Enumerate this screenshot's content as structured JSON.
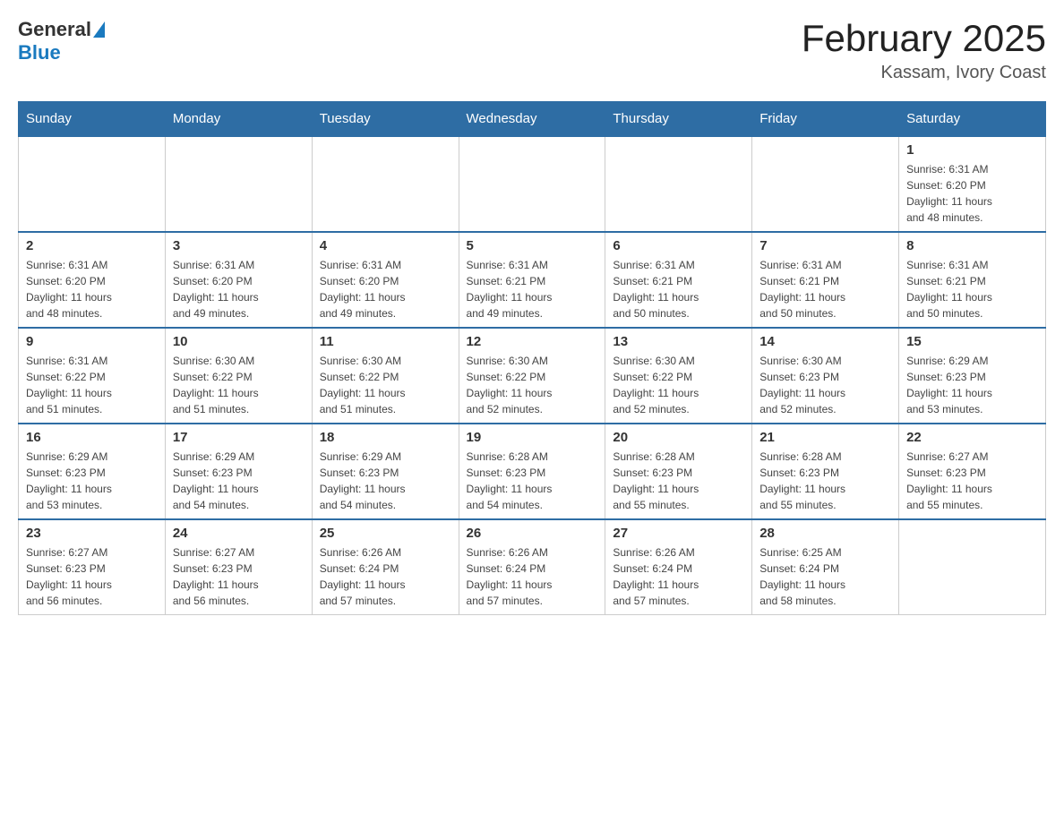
{
  "logo": {
    "text_general": "General",
    "text_blue": "Blue",
    "arrow_char": "▶"
  },
  "title": "February 2025",
  "subtitle": "Kassam, Ivory Coast",
  "days_of_week": [
    "Sunday",
    "Monday",
    "Tuesday",
    "Wednesday",
    "Thursday",
    "Friday",
    "Saturday"
  ],
  "weeks": [
    {
      "days": [
        {
          "date": "",
          "info": ""
        },
        {
          "date": "",
          "info": ""
        },
        {
          "date": "",
          "info": ""
        },
        {
          "date": "",
          "info": ""
        },
        {
          "date": "",
          "info": ""
        },
        {
          "date": "",
          "info": ""
        },
        {
          "date": "1",
          "info": "Sunrise: 6:31 AM\nSunset: 6:20 PM\nDaylight: 11 hours\nand 48 minutes."
        }
      ]
    },
    {
      "days": [
        {
          "date": "2",
          "info": "Sunrise: 6:31 AM\nSunset: 6:20 PM\nDaylight: 11 hours\nand 48 minutes."
        },
        {
          "date": "3",
          "info": "Sunrise: 6:31 AM\nSunset: 6:20 PM\nDaylight: 11 hours\nand 49 minutes."
        },
        {
          "date": "4",
          "info": "Sunrise: 6:31 AM\nSunset: 6:20 PM\nDaylight: 11 hours\nand 49 minutes."
        },
        {
          "date": "5",
          "info": "Sunrise: 6:31 AM\nSunset: 6:21 PM\nDaylight: 11 hours\nand 49 minutes."
        },
        {
          "date": "6",
          "info": "Sunrise: 6:31 AM\nSunset: 6:21 PM\nDaylight: 11 hours\nand 50 minutes."
        },
        {
          "date": "7",
          "info": "Sunrise: 6:31 AM\nSunset: 6:21 PM\nDaylight: 11 hours\nand 50 minutes."
        },
        {
          "date": "8",
          "info": "Sunrise: 6:31 AM\nSunset: 6:21 PM\nDaylight: 11 hours\nand 50 minutes."
        }
      ]
    },
    {
      "days": [
        {
          "date": "9",
          "info": "Sunrise: 6:31 AM\nSunset: 6:22 PM\nDaylight: 11 hours\nand 51 minutes."
        },
        {
          "date": "10",
          "info": "Sunrise: 6:30 AM\nSunset: 6:22 PM\nDaylight: 11 hours\nand 51 minutes."
        },
        {
          "date": "11",
          "info": "Sunrise: 6:30 AM\nSunset: 6:22 PM\nDaylight: 11 hours\nand 51 minutes."
        },
        {
          "date": "12",
          "info": "Sunrise: 6:30 AM\nSunset: 6:22 PM\nDaylight: 11 hours\nand 52 minutes."
        },
        {
          "date": "13",
          "info": "Sunrise: 6:30 AM\nSunset: 6:22 PM\nDaylight: 11 hours\nand 52 minutes."
        },
        {
          "date": "14",
          "info": "Sunrise: 6:30 AM\nSunset: 6:23 PM\nDaylight: 11 hours\nand 52 minutes."
        },
        {
          "date": "15",
          "info": "Sunrise: 6:29 AM\nSunset: 6:23 PM\nDaylight: 11 hours\nand 53 minutes."
        }
      ]
    },
    {
      "days": [
        {
          "date": "16",
          "info": "Sunrise: 6:29 AM\nSunset: 6:23 PM\nDaylight: 11 hours\nand 53 minutes."
        },
        {
          "date": "17",
          "info": "Sunrise: 6:29 AM\nSunset: 6:23 PM\nDaylight: 11 hours\nand 54 minutes."
        },
        {
          "date": "18",
          "info": "Sunrise: 6:29 AM\nSunset: 6:23 PM\nDaylight: 11 hours\nand 54 minutes."
        },
        {
          "date": "19",
          "info": "Sunrise: 6:28 AM\nSunset: 6:23 PM\nDaylight: 11 hours\nand 54 minutes."
        },
        {
          "date": "20",
          "info": "Sunrise: 6:28 AM\nSunset: 6:23 PM\nDaylight: 11 hours\nand 55 minutes."
        },
        {
          "date": "21",
          "info": "Sunrise: 6:28 AM\nSunset: 6:23 PM\nDaylight: 11 hours\nand 55 minutes."
        },
        {
          "date": "22",
          "info": "Sunrise: 6:27 AM\nSunset: 6:23 PM\nDaylight: 11 hours\nand 55 minutes."
        }
      ]
    },
    {
      "days": [
        {
          "date": "23",
          "info": "Sunrise: 6:27 AM\nSunset: 6:23 PM\nDaylight: 11 hours\nand 56 minutes."
        },
        {
          "date": "24",
          "info": "Sunrise: 6:27 AM\nSunset: 6:23 PM\nDaylight: 11 hours\nand 56 minutes."
        },
        {
          "date": "25",
          "info": "Sunrise: 6:26 AM\nSunset: 6:24 PM\nDaylight: 11 hours\nand 57 minutes."
        },
        {
          "date": "26",
          "info": "Sunrise: 6:26 AM\nSunset: 6:24 PM\nDaylight: 11 hours\nand 57 minutes."
        },
        {
          "date": "27",
          "info": "Sunrise: 6:26 AM\nSunset: 6:24 PM\nDaylight: 11 hours\nand 57 minutes."
        },
        {
          "date": "28",
          "info": "Sunrise: 6:25 AM\nSunset: 6:24 PM\nDaylight: 11 hours\nand 58 minutes."
        },
        {
          "date": "",
          "info": ""
        }
      ]
    }
  ]
}
